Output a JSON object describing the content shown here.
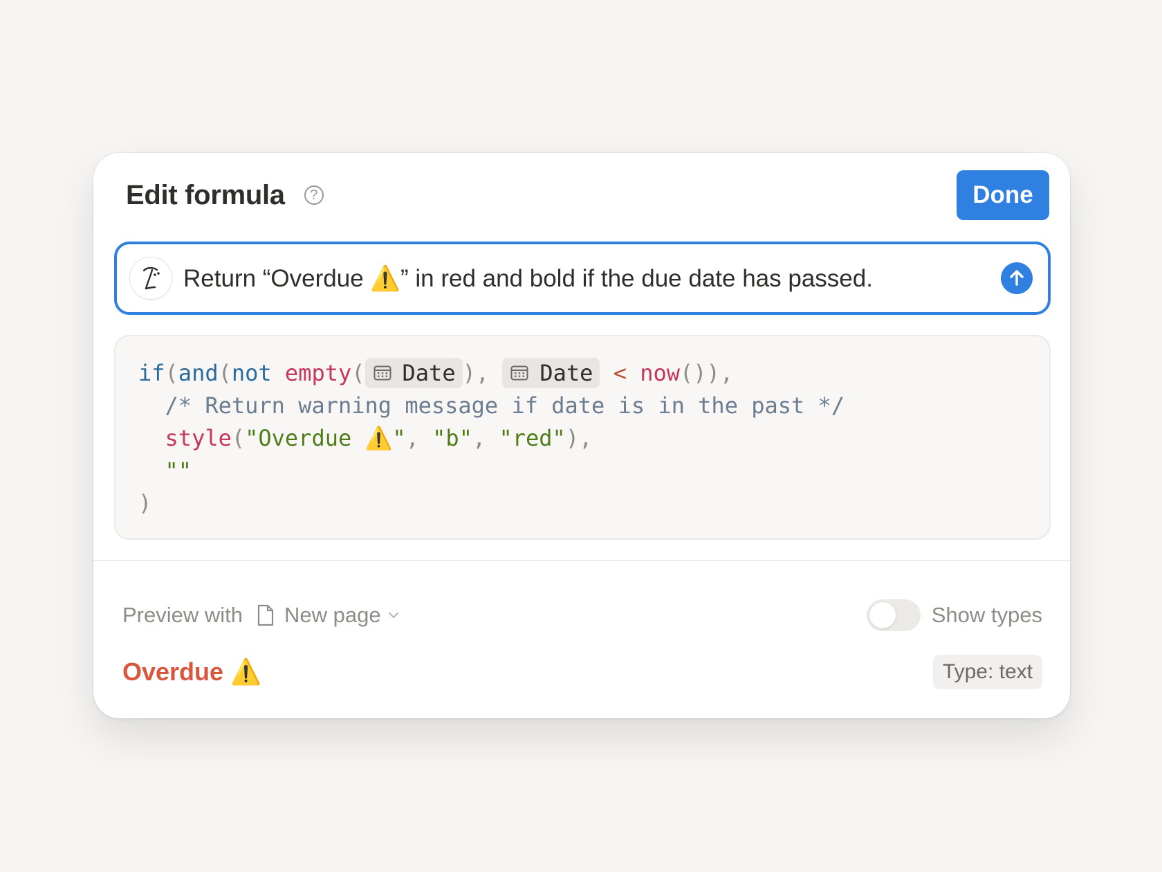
{
  "header": {
    "title": "Edit formula",
    "help_icon": "question-circle-icon",
    "done_label": "Done"
  },
  "prompt": {
    "text": "Return “Overdue ⚠️” in red and bold if the due date has passed.",
    "avatar_icon": "ai-face-icon",
    "send_icon": "arrow-up-icon"
  },
  "code": {
    "line1": {
      "if": "if",
      "p1": "(",
      "and": "and",
      "p2": "(",
      "not": "not",
      "empty": "empty",
      "p3": "(",
      "chip1": "Date",
      "p4": "),",
      "chip2": "Date",
      "lt": "<",
      "now": "now",
      "p5": "()),"
    },
    "line2": {
      "comment": "/* Return warning message if date is in the past */"
    },
    "line3": {
      "style": "style",
      "p1": "(",
      "s1": "\"Overdue ⚠️\"",
      "c1": ",",
      "s2": "\"b\"",
      "c2": ",",
      "s3": "\"red\"",
      "p2": "),"
    },
    "line4": {
      "empty_str": "\"\""
    },
    "line5": {
      "close": ")"
    },
    "chip_icon": "calendar-icon"
  },
  "preview": {
    "label": "Preview with",
    "page_icon": "page-icon",
    "page_name": "New page",
    "chevron_icon": "chevron-down-icon",
    "toggle_on": false,
    "show_types_label": "Show types"
  },
  "result": {
    "value": "Overdue ⚠️",
    "value_color": "#d8573d",
    "type_label": "Type: text"
  },
  "colors": {
    "accent": "#2f80e1",
    "background": "#f6f5f3"
  }
}
